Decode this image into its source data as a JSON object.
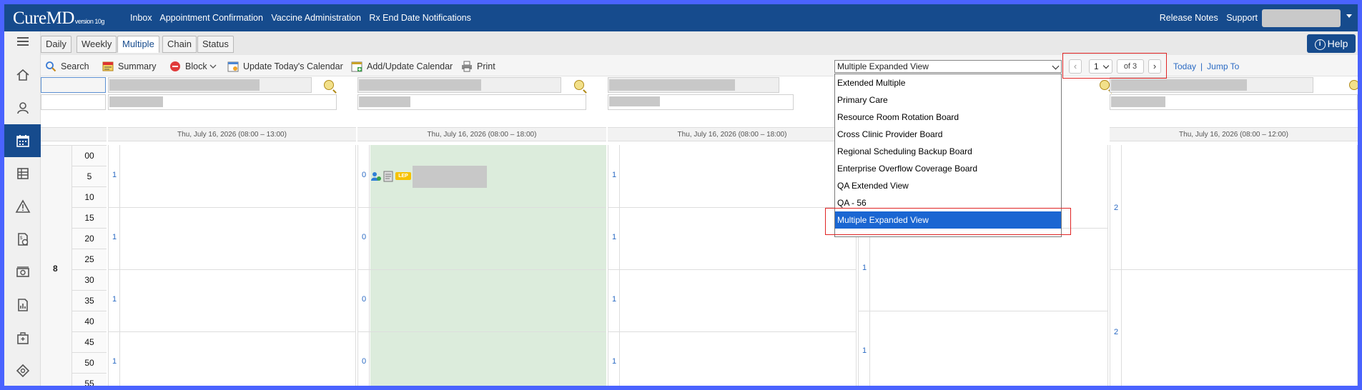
{
  "app": {
    "logo": "CureMD",
    "version": "version 10g"
  },
  "topnav": [
    "Inbox",
    "Appointment Confirmation",
    "Vaccine Administration",
    "Rx End Date Notifications"
  ],
  "topright": [
    "Release Notes",
    "Support"
  ],
  "tabs": [
    "Daily",
    "Weekly",
    "Multiple",
    "Chain",
    "Status"
  ],
  "active_tab": "Multiple",
  "help_label": "Help",
  "toolbar": {
    "search": "Search",
    "summary": "Summary",
    "block": "Block",
    "update_today": "Update Today's Calendar",
    "add_update": "Add/Update Calendar",
    "print": "Print"
  },
  "view_select": {
    "value": "Multiple Expanded View",
    "options": [
      "Extended Multiple",
      "Primary Care",
      "Resource Room Rotation Board",
      "Cross Clinic Provider Board",
      "Regional Scheduling Backup Board",
      "Enterprise Overflow Coverage Board",
      "QA Extended View",
      "QA - 56",
      "Multiple Expanded View"
    ]
  },
  "pager": {
    "page": "1",
    "of": "of 3",
    "prev": "‹",
    "next": "›"
  },
  "links": {
    "today": "Today",
    "sep": "|",
    "jump": "Jump To"
  },
  "calendar": {
    "hour": "8",
    "minutes": [
      "00",
      "5",
      "10",
      "15",
      "20",
      "25",
      "30",
      "35",
      "40",
      "45",
      "50",
      "55"
    ],
    "columns": [
      {
        "header": "Thu, July 16, 2026 (08:00 – 13:00)",
        "counts": [
          "1",
          "1",
          "1",
          "1"
        ]
      },
      {
        "header": "Thu, July 16, 2026 (08:00 – 18:00)",
        "counts": [
          "0",
          "0",
          "0",
          "0"
        ]
      },
      {
        "header": "Thu, July 16, 2026 (08:00 – 18:00)",
        "counts": [
          "1",
          "1",
          "1",
          "1"
        ]
      },
      {
        "header": "",
        "counts": [
          "1",
          "1"
        ]
      },
      {
        "header": "Thu, July 16, 2026 (08:00 – 12:00)",
        "counts": [
          "2",
          "2"
        ]
      }
    ],
    "badge": "LEP"
  },
  "colors": {
    "brand": "#164b8d",
    "link": "#2a6ac3",
    "available": "#dcecdc",
    "highlight": "#e02424",
    "selected": "#1a66d2"
  }
}
